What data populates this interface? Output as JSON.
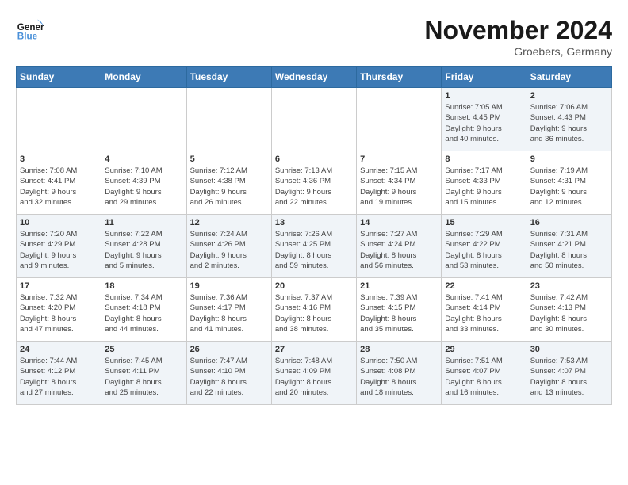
{
  "header": {
    "logo_line1": "General",
    "logo_line2": "Blue",
    "month": "November 2024",
    "location": "Groebers, Germany"
  },
  "weekdays": [
    "Sunday",
    "Monday",
    "Tuesday",
    "Wednesday",
    "Thursday",
    "Friday",
    "Saturday"
  ],
  "weeks": [
    [
      {
        "day": "",
        "info": ""
      },
      {
        "day": "",
        "info": ""
      },
      {
        "day": "",
        "info": ""
      },
      {
        "day": "",
        "info": ""
      },
      {
        "day": "",
        "info": ""
      },
      {
        "day": "1",
        "info": "Sunrise: 7:05 AM\nSunset: 4:45 PM\nDaylight: 9 hours\nand 40 minutes."
      },
      {
        "day": "2",
        "info": "Sunrise: 7:06 AM\nSunset: 4:43 PM\nDaylight: 9 hours\nand 36 minutes."
      }
    ],
    [
      {
        "day": "3",
        "info": "Sunrise: 7:08 AM\nSunset: 4:41 PM\nDaylight: 9 hours\nand 32 minutes."
      },
      {
        "day": "4",
        "info": "Sunrise: 7:10 AM\nSunset: 4:39 PM\nDaylight: 9 hours\nand 29 minutes."
      },
      {
        "day": "5",
        "info": "Sunrise: 7:12 AM\nSunset: 4:38 PM\nDaylight: 9 hours\nand 26 minutes."
      },
      {
        "day": "6",
        "info": "Sunrise: 7:13 AM\nSunset: 4:36 PM\nDaylight: 9 hours\nand 22 minutes."
      },
      {
        "day": "7",
        "info": "Sunrise: 7:15 AM\nSunset: 4:34 PM\nDaylight: 9 hours\nand 19 minutes."
      },
      {
        "day": "8",
        "info": "Sunrise: 7:17 AM\nSunset: 4:33 PM\nDaylight: 9 hours\nand 15 minutes."
      },
      {
        "day": "9",
        "info": "Sunrise: 7:19 AM\nSunset: 4:31 PM\nDaylight: 9 hours\nand 12 minutes."
      }
    ],
    [
      {
        "day": "10",
        "info": "Sunrise: 7:20 AM\nSunset: 4:29 PM\nDaylight: 9 hours\nand 9 minutes."
      },
      {
        "day": "11",
        "info": "Sunrise: 7:22 AM\nSunset: 4:28 PM\nDaylight: 9 hours\nand 5 minutes."
      },
      {
        "day": "12",
        "info": "Sunrise: 7:24 AM\nSunset: 4:26 PM\nDaylight: 9 hours\nand 2 minutes."
      },
      {
        "day": "13",
        "info": "Sunrise: 7:26 AM\nSunset: 4:25 PM\nDaylight: 8 hours\nand 59 minutes."
      },
      {
        "day": "14",
        "info": "Sunrise: 7:27 AM\nSunset: 4:24 PM\nDaylight: 8 hours\nand 56 minutes."
      },
      {
        "day": "15",
        "info": "Sunrise: 7:29 AM\nSunset: 4:22 PM\nDaylight: 8 hours\nand 53 minutes."
      },
      {
        "day": "16",
        "info": "Sunrise: 7:31 AM\nSunset: 4:21 PM\nDaylight: 8 hours\nand 50 minutes."
      }
    ],
    [
      {
        "day": "17",
        "info": "Sunrise: 7:32 AM\nSunset: 4:20 PM\nDaylight: 8 hours\nand 47 minutes."
      },
      {
        "day": "18",
        "info": "Sunrise: 7:34 AM\nSunset: 4:18 PM\nDaylight: 8 hours\nand 44 minutes."
      },
      {
        "day": "19",
        "info": "Sunrise: 7:36 AM\nSunset: 4:17 PM\nDaylight: 8 hours\nand 41 minutes."
      },
      {
        "day": "20",
        "info": "Sunrise: 7:37 AM\nSunset: 4:16 PM\nDaylight: 8 hours\nand 38 minutes."
      },
      {
        "day": "21",
        "info": "Sunrise: 7:39 AM\nSunset: 4:15 PM\nDaylight: 8 hours\nand 35 minutes."
      },
      {
        "day": "22",
        "info": "Sunrise: 7:41 AM\nSunset: 4:14 PM\nDaylight: 8 hours\nand 33 minutes."
      },
      {
        "day": "23",
        "info": "Sunrise: 7:42 AM\nSunset: 4:13 PM\nDaylight: 8 hours\nand 30 minutes."
      }
    ],
    [
      {
        "day": "24",
        "info": "Sunrise: 7:44 AM\nSunset: 4:12 PM\nDaylight: 8 hours\nand 27 minutes."
      },
      {
        "day": "25",
        "info": "Sunrise: 7:45 AM\nSunset: 4:11 PM\nDaylight: 8 hours\nand 25 minutes."
      },
      {
        "day": "26",
        "info": "Sunrise: 7:47 AM\nSunset: 4:10 PM\nDaylight: 8 hours\nand 22 minutes."
      },
      {
        "day": "27",
        "info": "Sunrise: 7:48 AM\nSunset: 4:09 PM\nDaylight: 8 hours\nand 20 minutes."
      },
      {
        "day": "28",
        "info": "Sunrise: 7:50 AM\nSunset: 4:08 PM\nDaylight: 8 hours\nand 18 minutes."
      },
      {
        "day": "29",
        "info": "Sunrise: 7:51 AM\nSunset: 4:07 PM\nDaylight: 8 hours\nand 16 minutes."
      },
      {
        "day": "30",
        "info": "Sunrise: 7:53 AM\nSunset: 4:07 PM\nDaylight: 8 hours\nand 13 minutes."
      }
    ]
  ]
}
